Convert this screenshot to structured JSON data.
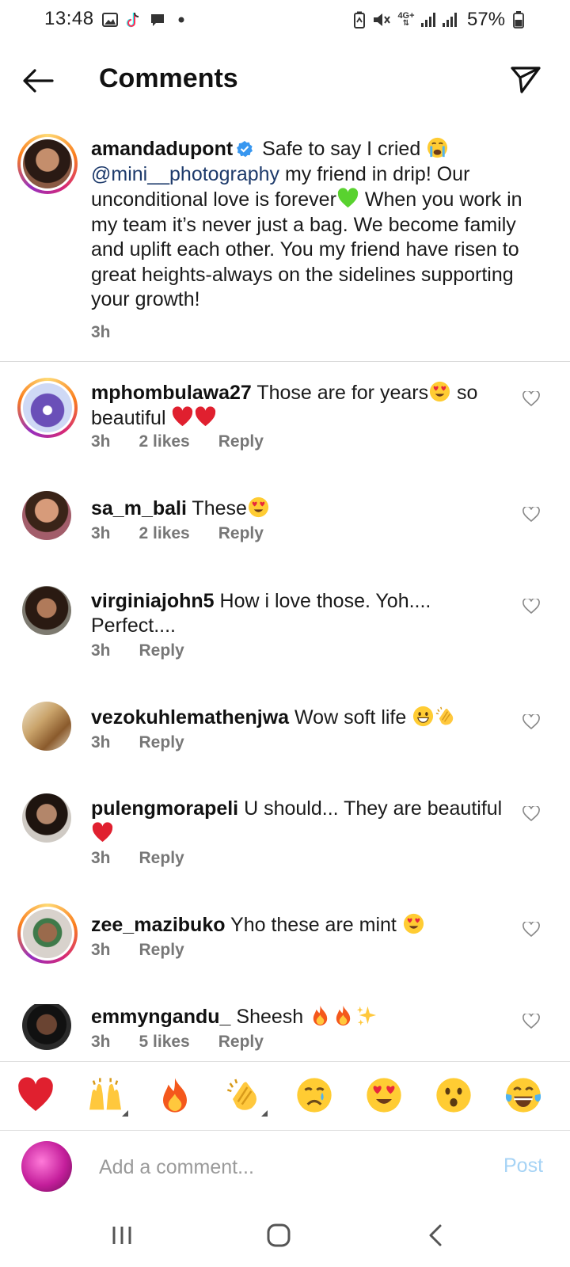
{
  "status_bar": {
    "time": "13:48",
    "network": "4G+",
    "battery": "57%",
    "left_icons": [
      "gallery-icon",
      "tiktok-icon",
      "message-icon",
      "dot-icon"
    ],
    "right_icons": [
      "battery-saver-icon",
      "mute-icon",
      "network-4g-icon",
      "signal-icon",
      "signal-icon",
      "battery-icon"
    ]
  },
  "header": {
    "title": "Comments"
  },
  "caption": {
    "username": "amandadupont",
    "text_start": "Safe to say I cried",
    "mention": "@mini__photography",
    "text_mid": " my friend in drip! Our unconditional love is forever",
    "text_end": " When you work in my team it’s never just a bag. We become family and uplift each other. You my friend have risen to great heights-always on the sidelines supporting your growth!",
    "time": "3h"
  },
  "comments": [
    {
      "username": "mphombulawa27",
      "text_a": "Those are for years",
      "text_b": " so beautiful ",
      "time": "3h",
      "likes": "2 likes",
      "reply": "Reply"
    },
    {
      "username": "sa_m_bali",
      "text_a": "These",
      "time": "3h",
      "likes": "2 likes",
      "reply": "Reply"
    },
    {
      "username": "virginiajohn5",
      "text_a": "How i love those.  Yoh.... Perfect....",
      "time": "3h",
      "reply": "Reply"
    },
    {
      "username": "vezokuhlemathenjwa",
      "text_a": "Wow soft life ",
      "time": "3h",
      "reply": "Reply"
    },
    {
      "username": "pulengmorapeli",
      "text_a": "U should... They are beautiful ",
      "time": "3h",
      "reply": "Reply"
    },
    {
      "username": "zee_mazibuko",
      "text_a": "Yho these are mint ",
      "time": "3h",
      "reply": "Reply"
    },
    {
      "username": "emmyngandu_",
      "text_a": "Sheesh ",
      "time": "3h",
      "likes": "5 likes",
      "reply": "Reply"
    }
  ],
  "reactions": [
    "red-heart",
    "raising-hands",
    "fire",
    "clapping-hands",
    "crying-face",
    "heart-eyes",
    "surprised-face",
    "tears-of-joy"
  ],
  "composer": {
    "placeholder": "Add a comment...",
    "post_label": "Post"
  },
  "colors": {
    "mention": "#1d3a6b",
    "post_disabled": "#a6d3f5",
    "verified": "#3897f0",
    "meta_gray": "#777777"
  }
}
